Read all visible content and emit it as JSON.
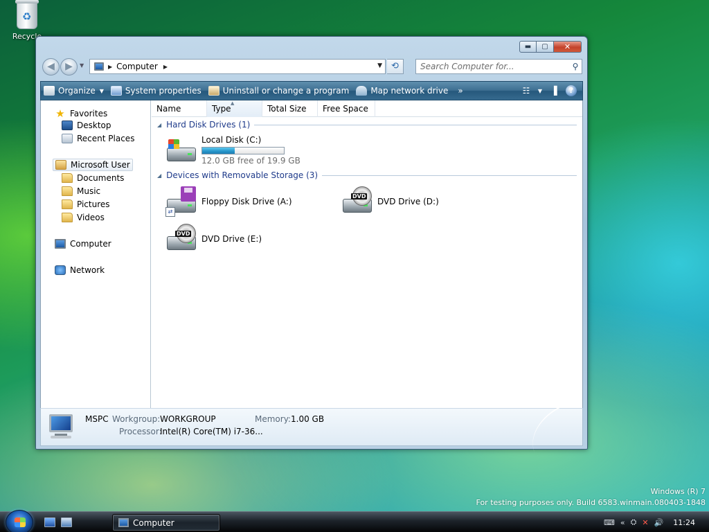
{
  "desktop": {
    "recycle_bin_label": "Recycle",
    "watermark_line1": "Windows (R) 7",
    "watermark_line2": "For testing purposes only. Build 6583.winmain.080403-1848"
  },
  "window": {
    "caption_buttons": {
      "minimize": "▬",
      "maximize": "▢",
      "close": "✕"
    }
  },
  "navigation": {
    "back_glyph": "◀",
    "forward_glyph": "▶",
    "breadcrumb": [
      "Computer"
    ],
    "search_placeholder": "Search Computer for..."
  },
  "command_bar": {
    "items": [
      {
        "label": "Organize",
        "icon": "organize-icon",
        "has_dropdown": true
      },
      {
        "label": "System properties",
        "icon": "system-properties-icon"
      },
      {
        "label": "Uninstall or change a program",
        "icon": "uninstall-icon"
      },
      {
        "label": "Map network drive",
        "icon": "map-network-drive-icon"
      }
    ],
    "more_glyph": "»"
  },
  "nav_pane": {
    "favorites_label": "Favorites",
    "desktop_label": "Desktop",
    "recent_places_label": "Recent Places",
    "user_label": "Microsoft User",
    "documents_label": "Documents",
    "music_label": "Music",
    "pictures_label": "Pictures",
    "videos_label": "Videos",
    "computer_label": "Computer",
    "network_label": "Network"
  },
  "columns": [
    "Name",
    "Type",
    "Total Size",
    "Free Space"
  ],
  "groups": {
    "hdd": {
      "title": "Hard Disk Drives (1)",
      "drives": [
        {
          "name": "Local Disk (C:)",
          "free_text": "12.0 GB free of 19.9 GB",
          "used_fraction": 0.397
        }
      ]
    },
    "removable": {
      "title": "Devices with Removable Storage (3)",
      "drives": [
        {
          "name": "Floppy Disk Drive (A:)",
          "type": "floppy"
        },
        {
          "name": "DVD Drive (D:)",
          "type": "dvd"
        },
        {
          "name": "DVD Drive (E:)",
          "type": "dvd"
        }
      ]
    },
    "dvd_label": "DVD"
  },
  "details": {
    "computer_name": "MSPC",
    "workgroup_label": "Workgroup:",
    "workgroup_value": "WORKGROUP",
    "memory_label": "Memory:",
    "memory_value": "1.00 GB",
    "processor_label": "Processor:",
    "processor_value": "Intel(R) Core(TM) i7-36..."
  },
  "taskbar": {
    "window_button_label": "Computer",
    "clock": "11:24"
  }
}
